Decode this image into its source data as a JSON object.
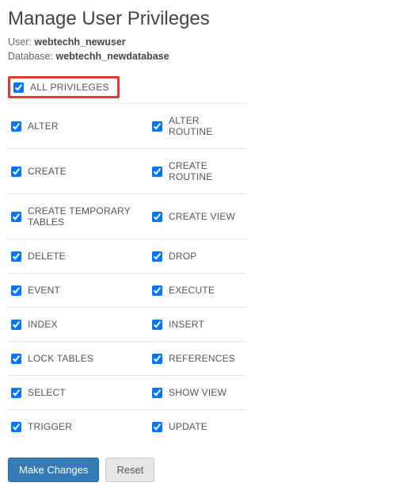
{
  "title": "Manage User Privileges",
  "meta": {
    "user_label": "User:",
    "user_value": "webtechh_newuser",
    "db_label": "Database:",
    "db_value": "webtechh_newdatabase"
  },
  "all_privileges": {
    "label": "ALL PRIVILEGES",
    "checked": true
  },
  "privileges": [
    {
      "left": {
        "label": "ALTER",
        "checked": true
      },
      "right": {
        "label": "ALTER ROUTINE",
        "checked": true
      }
    },
    {
      "left": {
        "label": "CREATE",
        "checked": true
      },
      "right": {
        "label": "CREATE ROUTINE",
        "checked": true
      }
    },
    {
      "left": {
        "label": "CREATE TEMPORARY TABLES",
        "checked": true
      },
      "right": {
        "label": "CREATE VIEW",
        "checked": true
      }
    },
    {
      "left": {
        "label": "DELETE",
        "checked": true
      },
      "right": {
        "label": "DROP",
        "checked": true
      }
    },
    {
      "left": {
        "label": "EVENT",
        "checked": true
      },
      "right": {
        "label": "EXECUTE",
        "checked": true
      }
    },
    {
      "left": {
        "label": "INDEX",
        "checked": true
      },
      "right": {
        "label": "INSERT",
        "checked": true
      }
    },
    {
      "left": {
        "label": "LOCK TABLES",
        "checked": true
      },
      "right": {
        "label": "REFERENCES",
        "checked": true
      }
    },
    {
      "left": {
        "label": "SELECT",
        "checked": true
      },
      "right": {
        "label": "SHOW VIEW",
        "checked": true
      }
    },
    {
      "left": {
        "label": "TRIGGER",
        "checked": true
      },
      "right": {
        "label": "UPDATE",
        "checked": true
      }
    }
  ],
  "buttons": {
    "submit": "Make Changes",
    "reset": "Reset"
  }
}
